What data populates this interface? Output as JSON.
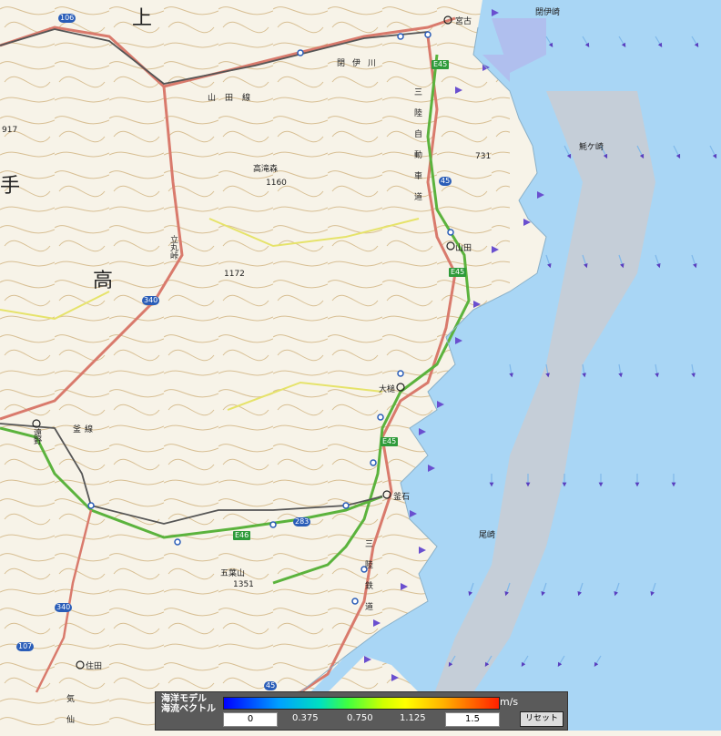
{
  "map": {
    "big_labels": [
      "上",
      "手",
      "高"
    ],
    "places": {
      "miyako": "宮古",
      "yamada": "山田",
      "otsuchi": "大槌",
      "kamaishi": "釜石",
      "tono": "遠野",
      "sumita": "住田",
      "heigashizaki": "閉伊崎",
      "todogasaki": "魹ケ崎",
      "ozaki": "尾崎"
    },
    "peaks": {
      "takatakimori": "高滝森",
      "takatakimori_elev": "1160",
      "peak_1172": "1172",
      "goyozan": "五葉山",
      "goyozan_elev": "1351",
      "peak_731": "731",
      "peak_917": "917"
    },
    "features": {
      "tachimaru_pass": "立丸峠",
      "yamada_line": "山田線",
      "heii_river": "閉伊川",
      "sanriku_road": "三陸自動車道",
      "sanriku_rail": "三陸鉄道",
      "kamaishi_line": "釜線",
      "kesen": "気仙"
    },
    "shields": {
      "e45a": "E45",
      "e45b": "E45",
      "e45c": "E45",
      "e46": "E46",
      "r45a": "45",
      "r45b": "45",
      "r106": "106",
      "r340a": "340",
      "r340b": "340",
      "r283": "283",
      "r107": "107"
    }
  },
  "legend": {
    "title_line1": "海洋モデル",
    "title_line2": "海流ベクトル",
    "unit": "m/s",
    "min_value": "0",
    "max_value": "1.5",
    "ticks": [
      "0.375",
      "0.750",
      "1.125"
    ],
    "reset_label": "リセット"
  },
  "colors": {
    "land": "#f7f3e8",
    "sea": "#a9d6f5",
    "contour": "#d4b98a",
    "road_national": "#d97a6c",
    "expressway": "#5bb33d",
    "prefectural_road": "#e6e36a",
    "railway": "#555555"
  }
}
